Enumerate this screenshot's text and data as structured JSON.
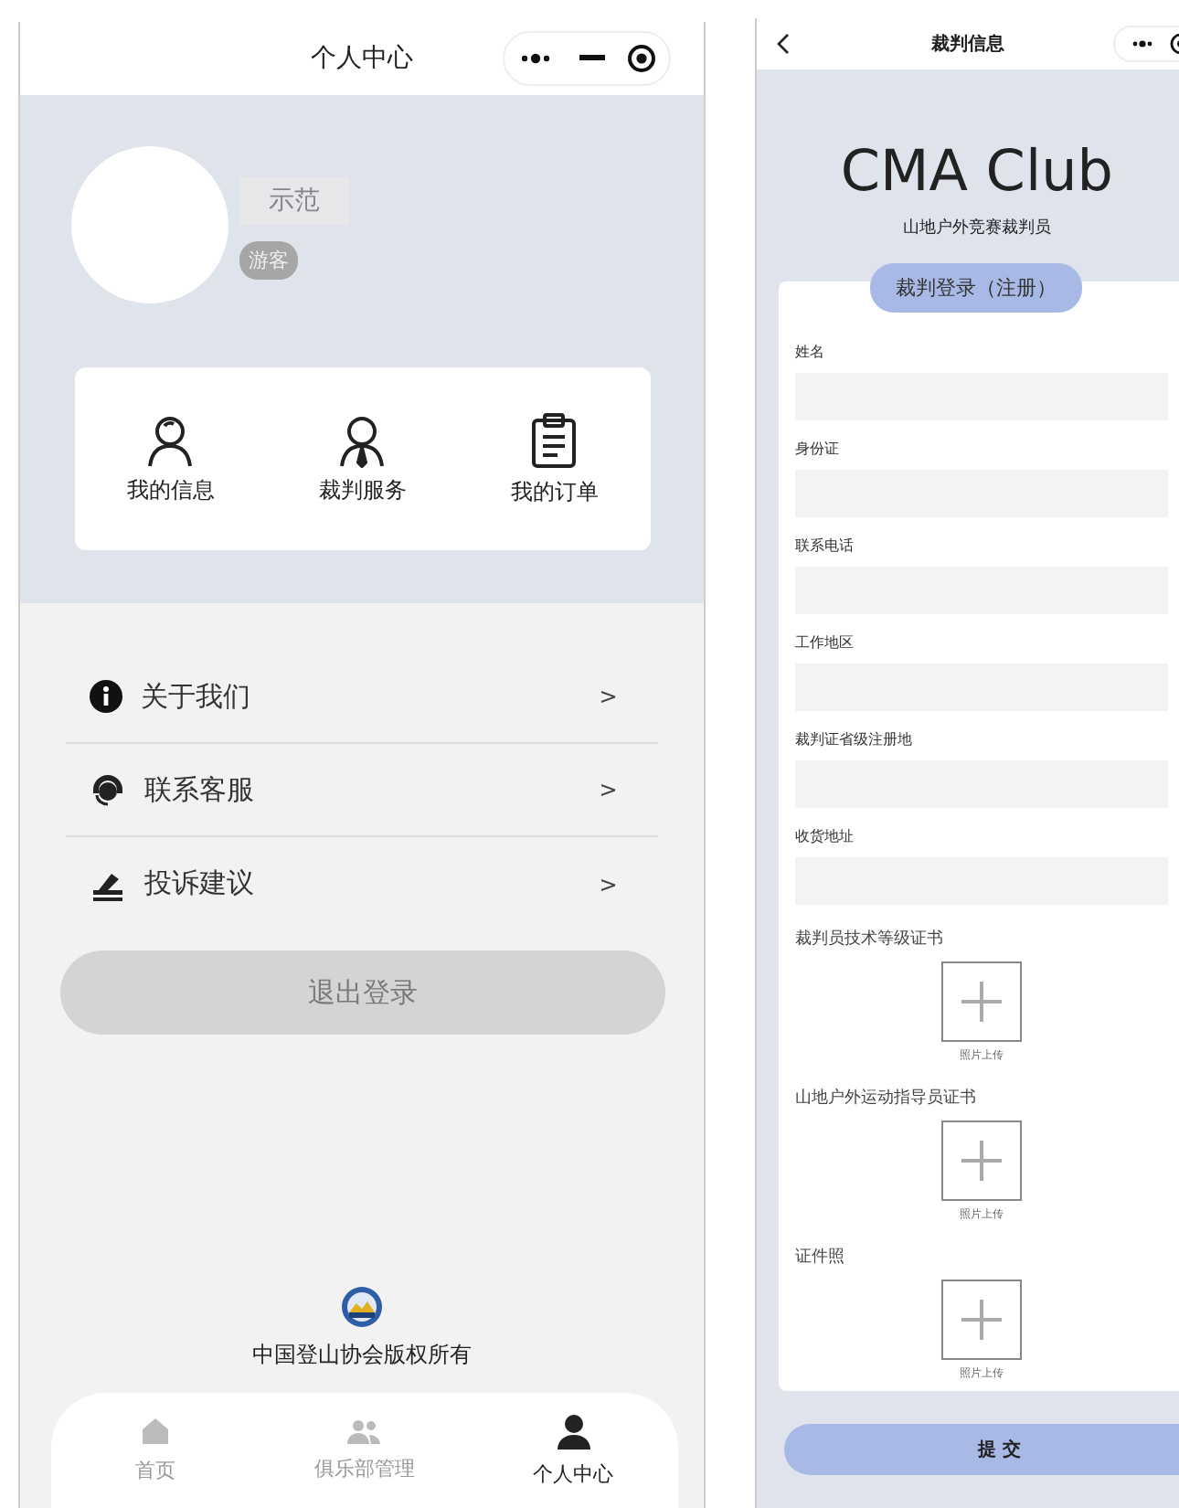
{
  "profile_screen": {
    "title": "个人中心",
    "user": {
      "name": "示范",
      "role": "游客"
    },
    "shortcuts": [
      {
        "label": "我的信息",
        "kind": "person"
      },
      {
        "label": "裁判服务",
        "kind": "referee"
      },
      {
        "label": "我的订单",
        "kind": "clipboard"
      }
    ],
    "menu": [
      {
        "label": "关于我们",
        "kind": "info",
        "arrow": ">"
      },
      {
        "label": "联系客服",
        "kind": "headset",
        "arrow": ">"
      },
      {
        "label": "投诉建议",
        "kind": "feedback",
        "arrow": ">"
      }
    ],
    "logout_button": "退出登录",
    "copyright": "中国登山协会版权所有",
    "tab_bar": [
      {
        "label": "首页",
        "kind": "home",
        "selected": false
      },
      {
        "label": "俱乐部管理",
        "kind": "group",
        "selected": false
      },
      {
        "label": "个人中心",
        "kind": "user",
        "selected": true
      }
    ]
  },
  "referee_screen": {
    "title": "裁判信息",
    "brand": "CMA Club",
    "subtitle": "山地户外竞赛裁判员",
    "login_tab": "裁判登录（注册）",
    "fields": [
      {
        "label": "姓名"
      },
      {
        "label": "身份证"
      },
      {
        "label": "联系电话"
      },
      {
        "label": "工作地区"
      },
      {
        "label": "裁判证省级注册地"
      },
      {
        "label": "收货地址"
      }
    ],
    "uploads": [
      {
        "label": "裁判员技术等级证书",
        "caption": "照片上传"
      },
      {
        "label": "山地户外运动指导员证书",
        "caption": "照片上传"
      },
      {
        "label": "证件照",
        "caption": "照片上传"
      }
    ],
    "submit_button": "提 交"
  }
}
